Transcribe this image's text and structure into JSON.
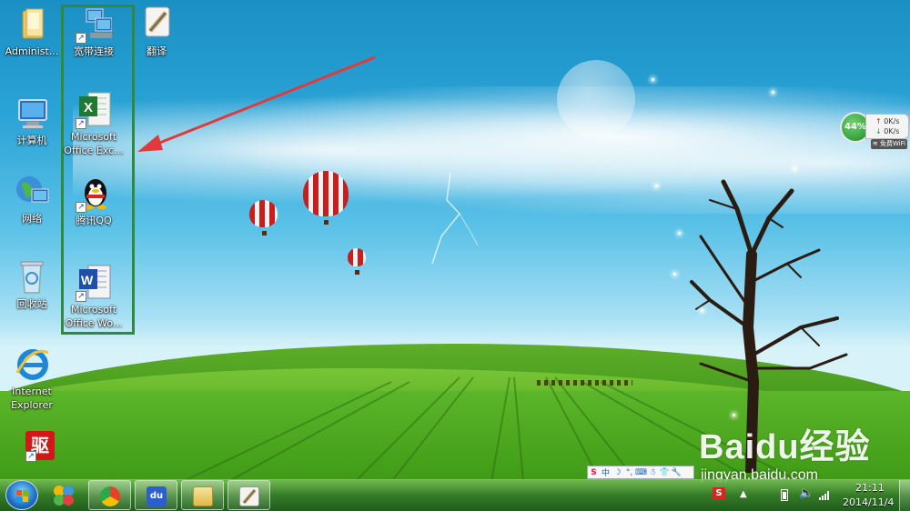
{
  "desktop": {
    "icons": [
      {
        "id": "administrator",
        "label": "Administ..."
      },
      {
        "id": "computer",
        "label": "计算机"
      },
      {
        "id": "network",
        "label": "网络"
      },
      {
        "id": "recycle-bin",
        "label": "回收站"
      },
      {
        "id": "ie",
        "label": "Internet\nExplorer"
      },
      {
        "id": "broadband",
        "label": "宽带连接"
      },
      {
        "id": "excel",
        "label": "Microsoft\nOffice Exc..."
      },
      {
        "id": "qq",
        "label": "腾讯QQ"
      },
      {
        "id": "word",
        "label": "Microsoft\nOffice Wo..."
      },
      {
        "id": "translate",
        "label": "翻译"
      },
      {
        "id": "driver",
        "label": "驱"
      }
    ]
  },
  "net_widget": {
    "percent": "44%",
    "upload": "0K/s",
    "download": "0K/s",
    "wifi": "免费WiFi"
  },
  "ime_bar": {
    "mode": "中"
  },
  "watermark": {
    "brand": "Baidu经验",
    "url": "jingyan.baidu.com"
  },
  "taskbar": {
    "time": "21:11",
    "date": "2014/11/4"
  },
  "colors": {
    "highlight_box": "#2f8a3c",
    "arrow": "#e03a3a"
  }
}
